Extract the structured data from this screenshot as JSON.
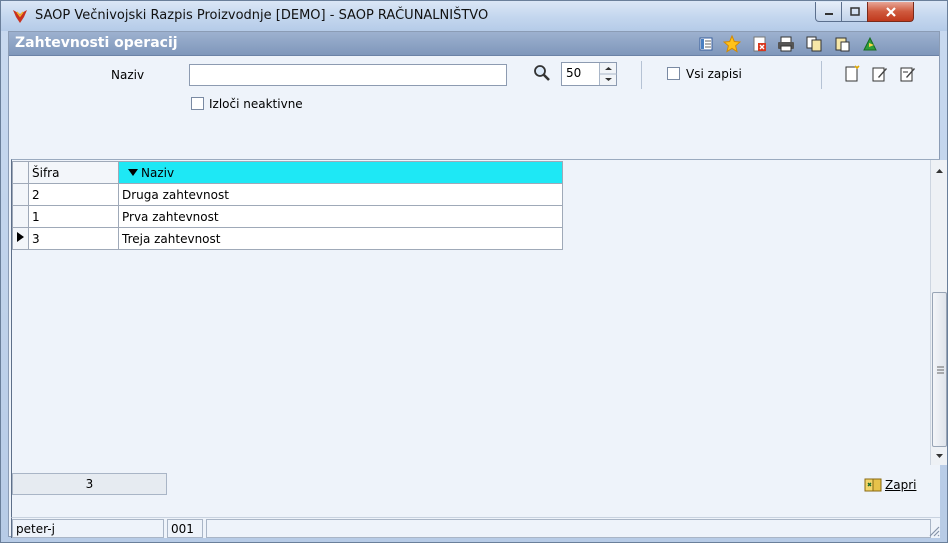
{
  "window": {
    "title": "SAOP  Večnivojski Razpis Proizvodnje [DEMO] - SAOP RAČUNALNIŠTVO"
  },
  "form": {
    "title": "Zahtevnosti operacij"
  },
  "filter": {
    "naziv_label": "Naziv",
    "naziv_value": "",
    "limit_value": "50",
    "vsi_zapisi_label": "Vsi zapisi",
    "izloci_label": "Izloči neaktivne"
  },
  "grid": {
    "columns": [
      "Šifra",
      "Naziv"
    ],
    "sort_column": "Naziv",
    "rows": [
      {
        "sifra": "2",
        "naziv": "Druga zahtevnost"
      },
      {
        "sifra": "1",
        "naziv": "Prva zahtevnost"
      },
      {
        "sifra": "3",
        "naziv": "Treja zahtevnost"
      }
    ],
    "selected_row_index": 2
  },
  "bottom": {
    "record_count": "3",
    "zapri_label": "Zapri"
  },
  "status": {
    "user": "peter-j",
    "company": "001"
  },
  "colors": {
    "sorted_header": "#1ee8f5",
    "title_bar": "#c3d6ee",
    "form_header": "#8ea4c7"
  }
}
